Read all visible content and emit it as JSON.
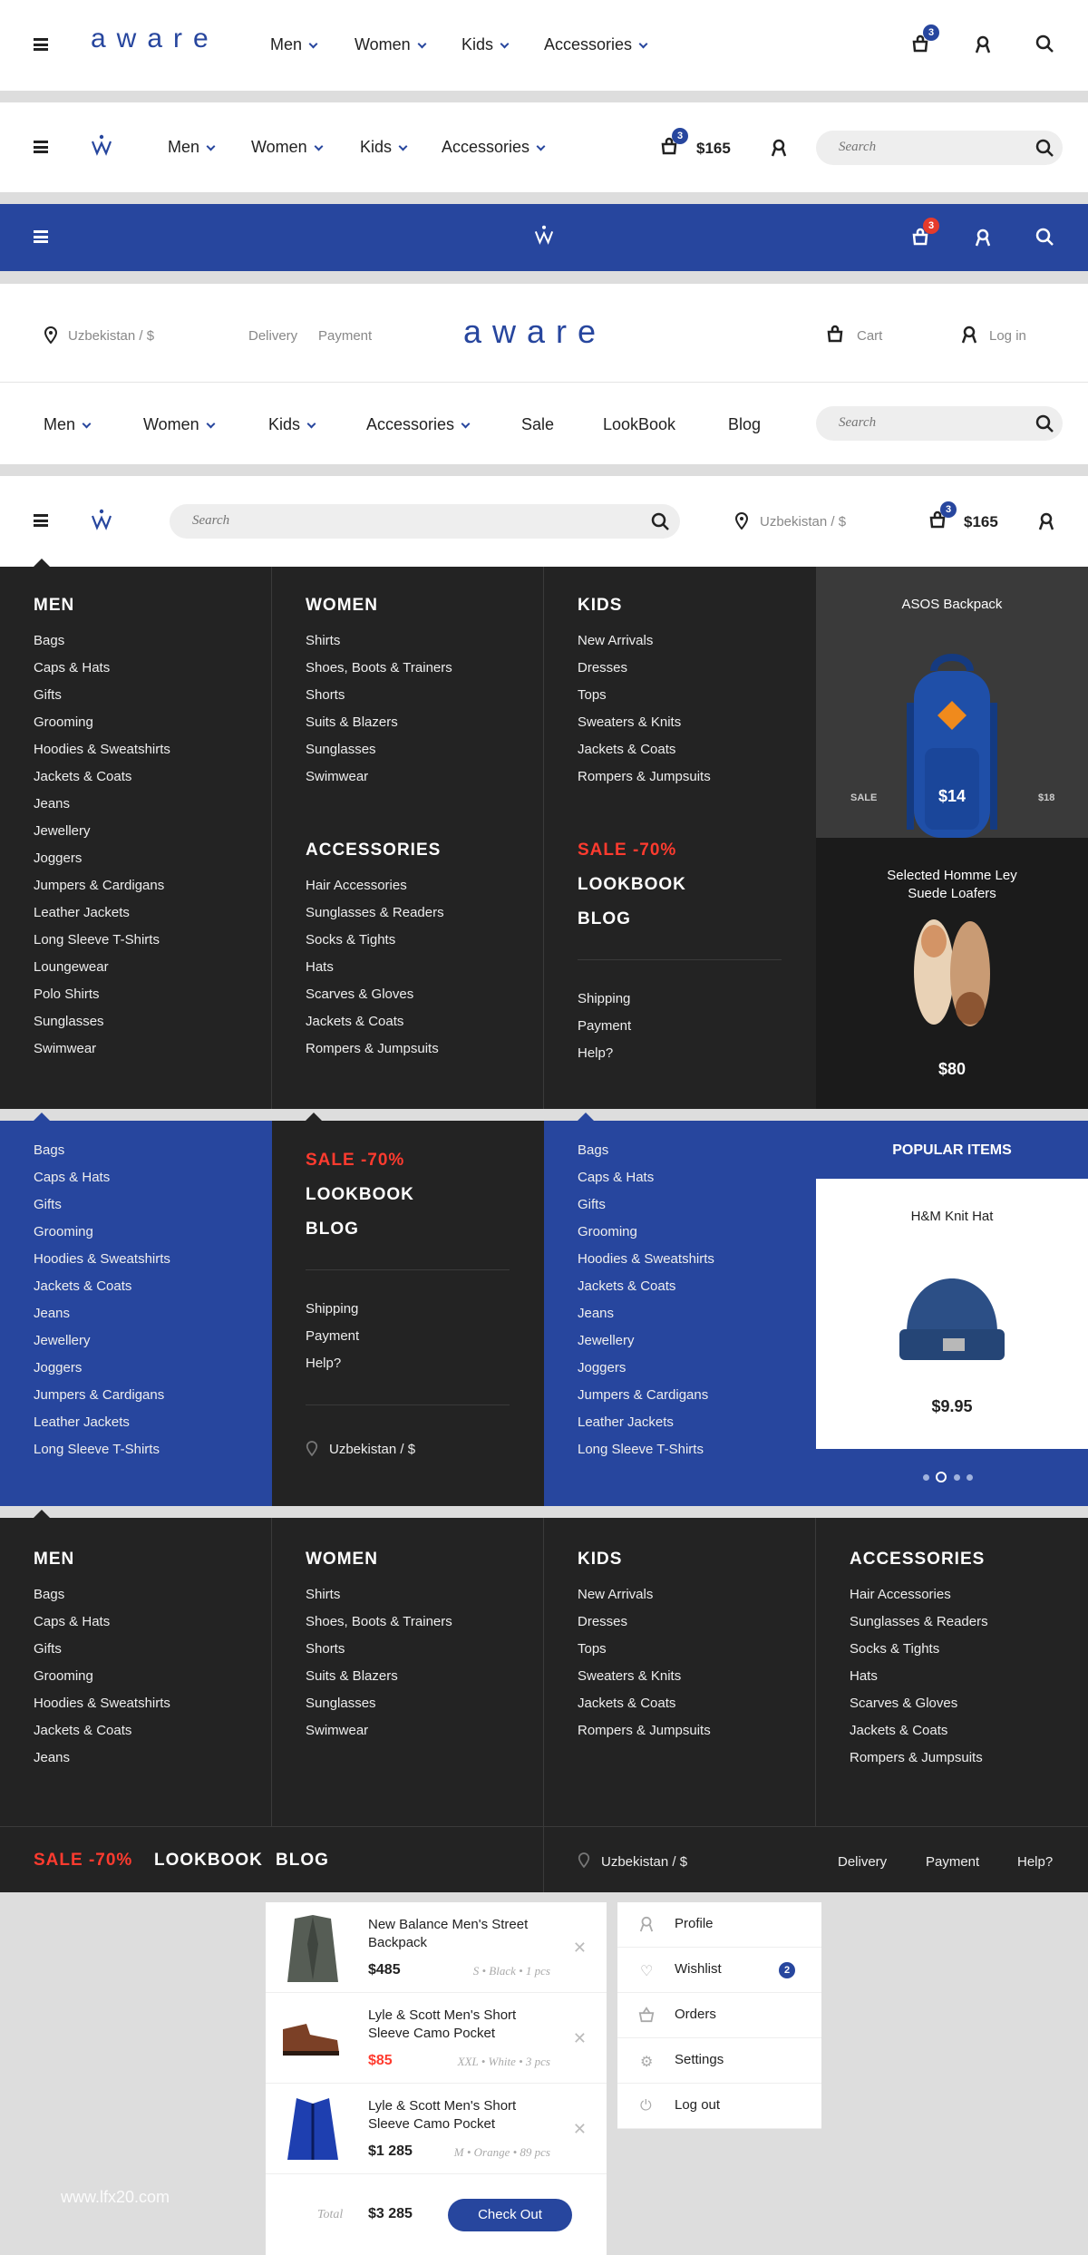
{
  "header1": {
    "logo": "aware",
    "nav": [
      "Men",
      "Women",
      "Kids",
      "Accessories"
    ],
    "cart_count": "3"
  },
  "header2": {
    "nav": [
      "Men",
      "Women",
      "Kids",
      "Accessories"
    ],
    "cart_count": "3",
    "cart_total": "$165",
    "search_placeholder": "Search"
  },
  "header3": {
    "cart_count": "3"
  },
  "header4": {
    "location": "Uzbekistan / $",
    "links": [
      "Delivery",
      "Payment"
    ],
    "logo": "aware",
    "cart_label": "Cart",
    "login_label": "Log in",
    "nav": [
      "Men",
      "Women",
      "Kids",
      "Accessories",
      "Sale",
      "LookBook",
      "Blog"
    ],
    "search_placeholder": "Search"
  },
  "header5": {
    "search_placeholder": "Search",
    "location": "Uzbekistan / $",
    "cart_count": "3",
    "cart_total": "$165"
  },
  "mega1": {
    "men_title": "MEN",
    "men": [
      "Bags",
      "Caps & Hats",
      "Gifts",
      "Grooming",
      "Hoodies & Sweatshirts",
      "Jackets & Coats",
      "Jeans",
      "Jewellery",
      "Joggers",
      "Jumpers & Cardigans",
      "Leather Jackets",
      "Long Sleeve T-Shirts",
      "Loungewear",
      "Polo Shirts",
      "Sunglasses",
      "Swimwear"
    ],
    "women_title": "WOMEN",
    "women": [
      "Shirts",
      "Shoes, Boots & Trainers",
      "Shorts",
      "Suits & Blazers",
      "Sunglasses",
      "Swimwear"
    ],
    "acc_title": "ACCESSORIES",
    "acc": [
      "Hair Accessories",
      "Sunglasses & Readers",
      "Socks & Tights",
      "Hats",
      "Scarves & Gloves",
      "Jackets & Coats",
      "Rompers & Jumpsuits"
    ],
    "kids_title": "KIDS",
    "kids": [
      "New Arrivals",
      "Dresses",
      "Tops",
      "Sweaters & Knits",
      "Jackets & Coats",
      "Rompers & Jumpsuits"
    ],
    "sale": "SALE -70%",
    "lookbook": "LOOKBOOK",
    "blog": "BLOG",
    "info": [
      "Shipping",
      "Payment",
      "Help?"
    ],
    "prod1": {
      "title": "ASOS Backpack",
      "sale_label": "SALE",
      "price": "$14",
      "old": "$18"
    },
    "prod2": {
      "title": "Selected Homme Ley Suede Loafers",
      "price": "$80"
    }
  },
  "mega2": {
    "list": [
      "Bags",
      "Caps & Hats",
      "Gifts",
      "Grooming",
      "Hoodies & Sweatshirts",
      "Jackets & Coats",
      "Jeans",
      "Jewellery",
      "Joggers",
      "Jumpers & Cardigans",
      "Leather Jackets",
      "Long Sleeve T-Shirts"
    ],
    "sale": "SALE -70%",
    "lookbook": "LOOKBOOK",
    "blog": "BLOG",
    "info": [
      "Shipping",
      "Payment",
      "Help?"
    ],
    "location": "Uzbekistan / $",
    "popular_title": "POPULAR ITEMS",
    "prod": {
      "title": "H&M Knit Hat",
      "price": "$9.95"
    }
  },
  "mega3": {
    "men_title": "MEN",
    "men": [
      "Bags",
      "Caps & Hats",
      "Gifts",
      "Grooming",
      "Hoodies & Sweatshirts",
      "Jackets & Coats",
      "Jeans"
    ],
    "women_title": "WOMEN",
    "women": [
      "Shirts",
      "Shoes, Boots & Trainers",
      "Shorts",
      "Suits & Blazers",
      "Sunglasses",
      "Swimwear"
    ],
    "kids_title": "KIDS",
    "kids": [
      "New Arrivals",
      "Dresses",
      "Tops",
      "Sweaters & Knits",
      "Jackets & Coats",
      "Rompers & Jumpsuits"
    ],
    "acc_title": "ACCESSORIES",
    "acc": [
      "Hair Accessories",
      "Sunglasses & Readers",
      "Socks & Tights",
      "Hats",
      "Scarves & Gloves",
      "Jackets & Coats",
      "Rompers & Jumpsuits"
    ],
    "sale": "SALE -70%",
    "lookbook": "LOOKBOOK",
    "blog": "BLOG",
    "location": "Uzbekistan / $",
    "links": [
      "Delivery",
      "Payment",
      "Help?"
    ]
  },
  "cart": {
    "items": [
      {
        "name": "New Balance Men's Street Backpack",
        "price": "$485",
        "meta": "S • Black • 1 pcs"
      },
      {
        "name": "Lyle & Scott Men's Short Sleeve Camo Pocket",
        "price": "$85",
        "meta": "XXL • White • 3 pcs"
      },
      {
        "name": "Lyle & Scott Men's Short Sleeve Camo Pocket",
        "price": "$1 285",
        "meta": "M • Orange • 89 pcs"
      }
    ],
    "total_label": "Total",
    "total": "$3 285",
    "checkout": "Check Out"
  },
  "account": {
    "items": [
      "Profile",
      "Wishlist",
      "Orders",
      "Settings",
      "Log out"
    ],
    "wishlist_count": "2"
  },
  "watermark": "www.lfx20.com",
  "colors": {
    "brand": "#27469e",
    "sale": "#ff3b2f",
    "dark": "#232323"
  }
}
